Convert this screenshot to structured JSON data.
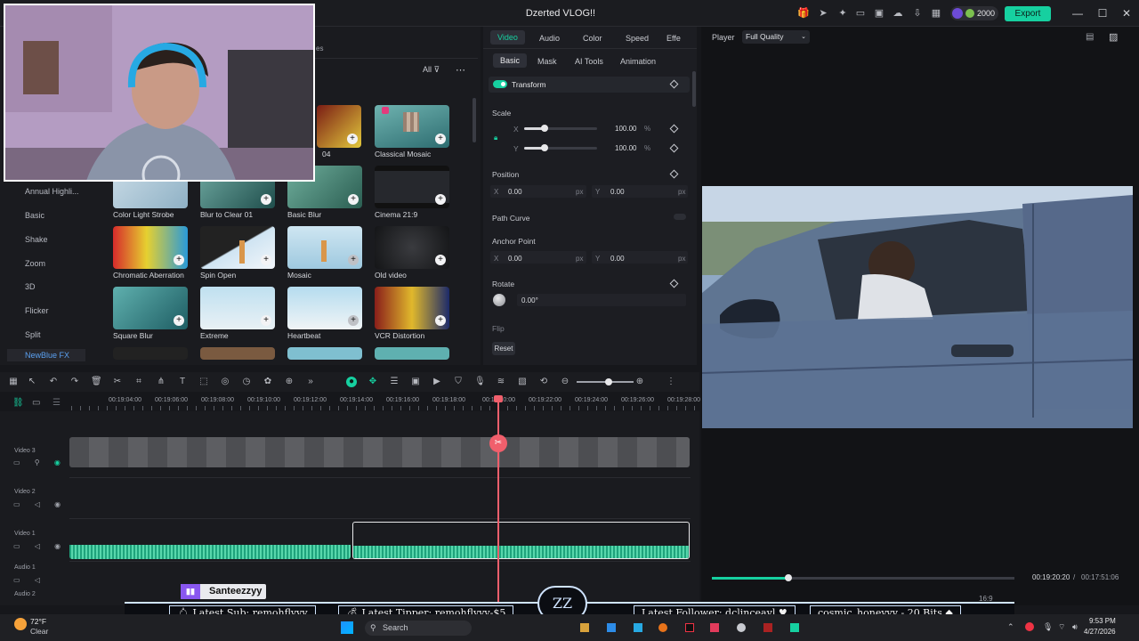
{
  "app": {
    "title": "Dzerted VLOG!!",
    "credits": "2000",
    "export_label": "Export"
  },
  "library": {
    "filter_label": "All",
    "tab_partial": "es",
    "categories": [
      "Annual Highli...",
      "Basic",
      "Shake",
      "Zoom",
      "3D",
      "Flicker",
      "Split",
      "NewBlue FX"
    ],
    "tiles": [
      {
        "label": "04"
      },
      {
        "label": "Classical Mosaic"
      },
      {
        "label": "Color Light Strobe"
      },
      {
        "label": "Blur to Clear 01"
      },
      {
        "label": "Basic Blur"
      },
      {
        "label": "Cinema 21:9"
      },
      {
        "label": "Chromatic Aberration"
      },
      {
        "label": "Spin Open"
      },
      {
        "label": "Mosaic"
      },
      {
        "label": "Old video"
      },
      {
        "label": "Square Blur"
      },
      {
        "label": "Extreme"
      },
      {
        "label": "Heartbeat"
      },
      {
        "label": "VCR Distortion"
      }
    ]
  },
  "properties": {
    "tabs": [
      "Video",
      "Audio",
      "Color",
      "Speed",
      "Effe"
    ],
    "subtabs": [
      "Basic",
      "Mask",
      "AI Tools",
      "Animation"
    ],
    "transform_label": "Transform",
    "scale": {
      "label": "Scale",
      "x_axis": "X",
      "y_axis": "Y",
      "x_value": "100.00",
      "y_value": "100.00",
      "unit": "%"
    },
    "position": {
      "label": "Position",
      "x_axis": "X",
      "y_axis": "Y",
      "x_value": "0.00",
      "y_value": "0.00",
      "unit": "px"
    },
    "path_curve_label": "Path Curve",
    "anchor": {
      "label": "Anchor Point",
      "x_axis": "X",
      "y_axis": "Y",
      "x_value": "0.00",
      "y_value": "0.00",
      "unit": "px"
    },
    "rotate": {
      "label": "Rotate",
      "value": "0.00°"
    },
    "flip_label": "Flip",
    "reset_label": "Reset"
  },
  "player": {
    "label": "Player",
    "quality": "Full Quality",
    "current_time": "00:19:20:20",
    "separator": "/",
    "total_time": "00:17:51:06",
    "progress": 0.253,
    "aspect": "16:9"
  },
  "timeline": {
    "ticks": [
      "00:19:04:00",
      "00:19:06:00",
      "00:19:08:00",
      "00:19:10:00",
      "00:19:12:00",
      "00:19:14:00",
      "00:19:16:00",
      "00:19:18:00",
      "00:19:20:00",
      "00:19:22:00",
      "00:19:24:00",
      "00:19:26:00",
      "00:19:28:00"
    ],
    "tracks": [
      "Video 3",
      "Video 2",
      "Video 1",
      "Audio 1",
      "Audio 2"
    ]
  },
  "overlay": {
    "streamer": "Santeezzyy",
    "ticker": [
      "Latest Sub: remohflyyy",
      "Latest Tipper: remohflyyy-$5",
      "Latest Follower: dclinceayl",
      "cosmic_honeyyy - 20 Bits"
    ]
  },
  "taskbar": {
    "temp": "72°F",
    "weather": "Clear",
    "search": "Search",
    "time": "9:53 PM",
    "date": "4/27/2026"
  },
  "colors": {
    "accent": "#16d0a0",
    "playhead": "#f05f6c",
    "twitch": "#8957f0"
  }
}
